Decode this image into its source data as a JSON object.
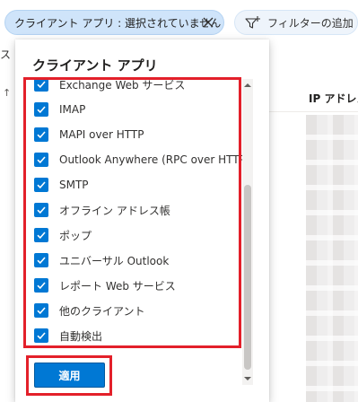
{
  "filters": {
    "client_chip_label": "クライアント アプリ : 選択されていません",
    "add_filter_label": "フィルターの追加"
  },
  "background": {
    "left_fragment_1": "ス プ",
    "left_fragment_2": "↑",
    "ip_column_header": "IP アドレス"
  },
  "popup": {
    "title": "クライアント アプリ",
    "options": [
      {
        "label": "Exchange Web サービス",
        "checked": true
      },
      {
        "label": "IMAP",
        "checked": true
      },
      {
        "label": "MAPI over HTTP",
        "checked": true
      },
      {
        "label": "Outlook Anywhere (RPC over HTTP)",
        "checked": true
      },
      {
        "label": "SMTP",
        "checked": true
      },
      {
        "label": "オフライン アドレス帳",
        "checked": true
      },
      {
        "label": "ポップ",
        "checked": true
      },
      {
        "label": "ユニバーサル Outlook",
        "checked": true
      },
      {
        "label": "レポート Web サービス",
        "checked": true
      },
      {
        "label": "他のクライアント",
        "checked": true
      },
      {
        "label": "自動検出",
        "checked": true
      }
    ],
    "apply_label": "適用"
  },
  "colors": {
    "accent": "#0078d4",
    "highlight_red": "#e3202a",
    "chip_bg": "#cfe4fa"
  }
}
